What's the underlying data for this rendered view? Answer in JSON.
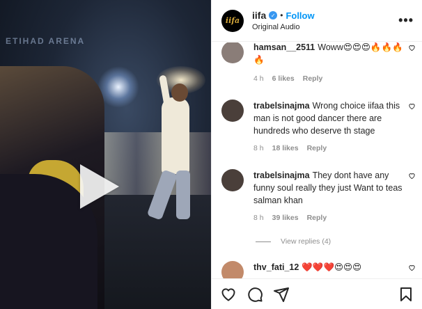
{
  "video": {
    "arena_text": "ETIHAD ARENA"
  },
  "header": {
    "username": "iifa",
    "avatar_text": "iifa",
    "follow_label": "Follow",
    "dot": "•",
    "audio": "Original Audio",
    "more": "•••"
  },
  "comments": [
    {
      "user": "hamsan__2511",
      "text": "Woww😍😍😍🔥🔥🔥🔥",
      "time": "4 h",
      "likes": "6 likes",
      "reply": "Reply",
      "avatar_color": "#8a7d78"
    },
    {
      "user": "trabelsinajma",
      "text": "Wrong choice iifaa this man is not good dancer there are hundreds who deserve th stage",
      "time": "8 h",
      "likes": "18 likes",
      "reply": "Reply",
      "avatar_color": "#4a3f3a"
    },
    {
      "user": "trabelsinajma",
      "text": "They dont have any funny soul really they just Want to teas salman khan",
      "time": "8 h",
      "likes": "39 likes",
      "reply": "Reply",
      "avatar_color": "#4a3f3a"
    },
    {
      "user": "thv_fati_12",
      "text": "❤️❤️❤️😍😍😍",
      "avatar_color": "#c28a6a"
    }
  ],
  "view_replies": "View replies (4)",
  "icons": [
    "heart-icon",
    "comment-icon",
    "share-icon",
    "save-icon",
    "play-icon",
    "more-icon",
    "verified-icon"
  ]
}
